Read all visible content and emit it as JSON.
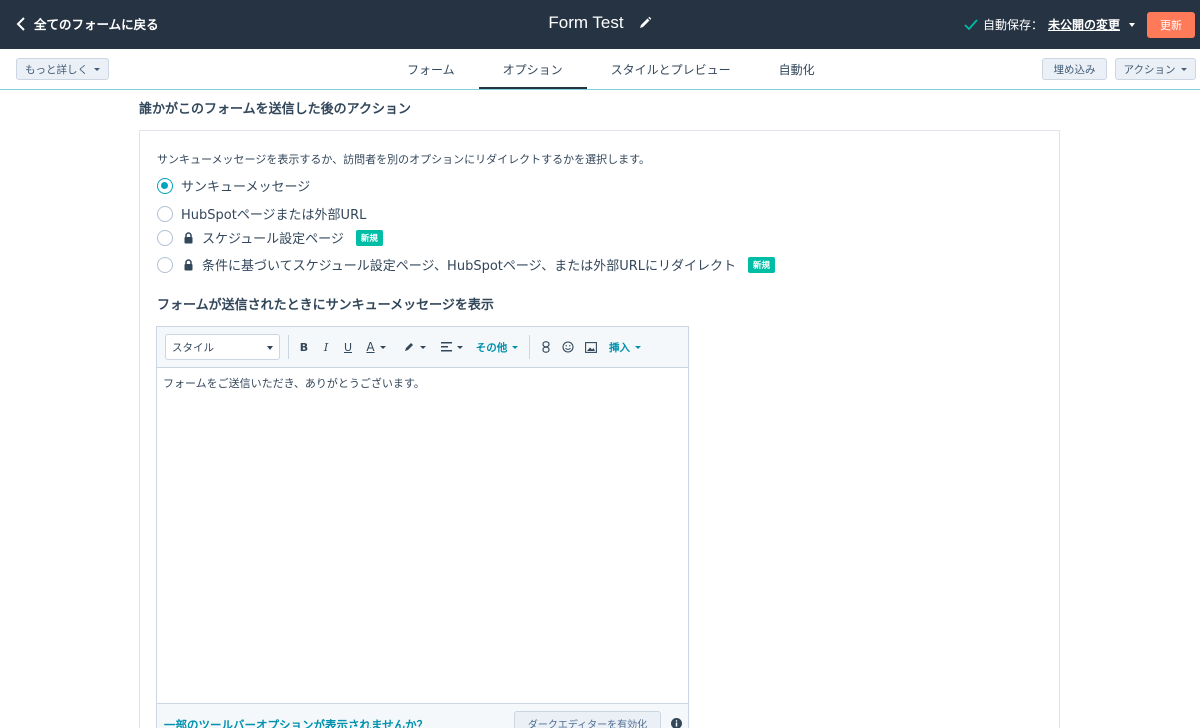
{
  "header": {
    "back_label": "全てのフォームに戻る",
    "title": "Form Test",
    "autosave_label": "自動保存：",
    "autosave_link": "未公開の変更",
    "update_button": "更新"
  },
  "subnav": {
    "more_button": "もっと詳しく",
    "tabs": [
      {
        "label": "フォーム",
        "active": false
      },
      {
        "label": "オプション",
        "active": true
      },
      {
        "label": "スタイルとプレビュー",
        "active": false
      },
      {
        "label": "自動化",
        "active": false
      }
    ],
    "embed_button": "埋め込み",
    "actions_button": "アクション"
  },
  "content": {
    "section_title": "誰かがこのフォームを送信した後のアクション",
    "description": "サンキューメッセージを表示するか、訪問者を別のオプションにリダイレクトするかを選択します。",
    "options": [
      {
        "label": "サンキューメッセージ",
        "checked": true,
        "locked": false,
        "badge": ""
      },
      {
        "label": "HubSpotページまたは外部URL",
        "checked": false,
        "locked": false,
        "badge": ""
      },
      {
        "label": "スケジュール設定ページ",
        "checked": false,
        "locked": true,
        "badge": "新規"
      },
      {
        "label": "条件に基づいてスケジュール設定ページ、HubSpotページ、または外部URLにリダイレクト",
        "checked": false,
        "locked": true,
        "badge": "新規"
      }
    ],
    "thankyou_title": "フォームが送信されたときにサンキューメッセージを表示"
  },
  "editor": {
    "style_select": "スタイル",
    "bold": "B",
    "italic": "I",
    "underline": "U",
    "font_color": "A",
    "more_label": "その他",
    "insert_label": "挿入",
    "body_text": "フォームをご送信いただき、ありがとうございます。",
    "footer_link": "一部のツールバーオプションが表示されませんか？",
    "dark_editor_button": "ダークエディターを有効化"
  },
  "colors": {
    "header_bg": "#253342",
    "accent_orange": "#ff7a59",
    "accent_teal": "#00a4bd",
    "badge_green": "#00bda5",
    "link_blue": "#0091ae"
  }
}
